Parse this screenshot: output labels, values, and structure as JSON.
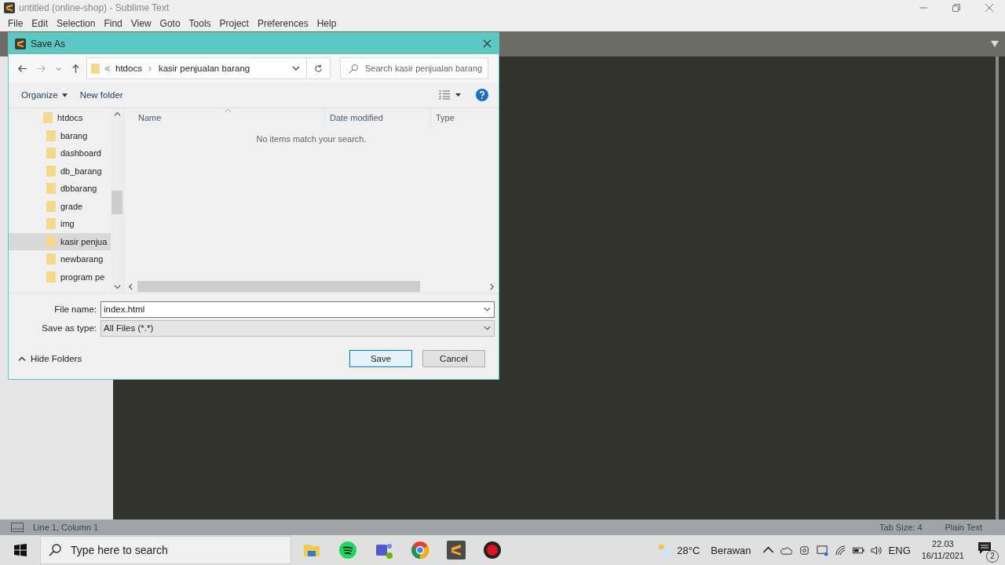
{
  "window": {
    "title": "untitled (online-shop) - Sublime Text"
  },
  "menu": [
    "File",
    "Edit",
    "Selection",
    "Find",
    "View",
    "Goto",
    "Tools",
    "Project",
    "Preferences",
    "Help"
  ],
  "dialog": {
    "title": "Save As",
    "address": [
      "htdocs",
      "kasir penjualan barang"
    ],
    "search": {
      "placeholder": "Search kasir penjualan barang"
    },
    "toolbar": {
      "organize": "Organize",
      "new_folder": "New folder"
    },
    "tree": [
      {
        "label": "htdocs",
        "selected": false,
        "children": [
          {
            "label": "barang",
            "selected": false
          },
          {
            "label": "dashboard",
            "selected": false
          },
          {
            "label": "db_barang",
            "selected": false
          },
          {
            "label": "dbbarang",
            "selected": false
          },
          {
            "label": "grade",
            "selected": false
          },
          {
            "label": "img",
            "selected": false
          },
          {
            "label": "kasir penjua",
            "selected": true
          },
          {
            "label": "newbarang",
            "selected": false
          },
          {
            "label": "program pe",
            "selected": false
          }
        ]
      }
    ],
    "columns": [
      "Name",
      "Date modified",
      "Type"
    ],
    "empty_message": "No items match your search.",
    "file_name": {
      "label": "File name:",
      "value": "index.html"
    },
    "save_type": {
      "label": "Save as type:",
      "value": "All Files (*.*)"
    },
    "hide_folders": "Hide Folders",
    "buttons": [
      {
        "label": "Save",
        "kind": "primary"
      },
      {
        "label": "Cancel",
        "kind": "secondary"
      }
    ]
  },
  "status_bar": {
    "position": "Line 1, Column 1",
    "tab_size": "Tab Size: 4",
    "syntax": "Plain Text"
  },
  "taskbar": {
    "search": {
      "placeholder": "Type here to search"
    },
    "weather": {
      "temp": "28°C",
      "condition": "Berawan"
    },
    "language": "ENG",
    "time": "22.03",
    "date": "16/11/2021",
    "notifications": "2"
  }
}
